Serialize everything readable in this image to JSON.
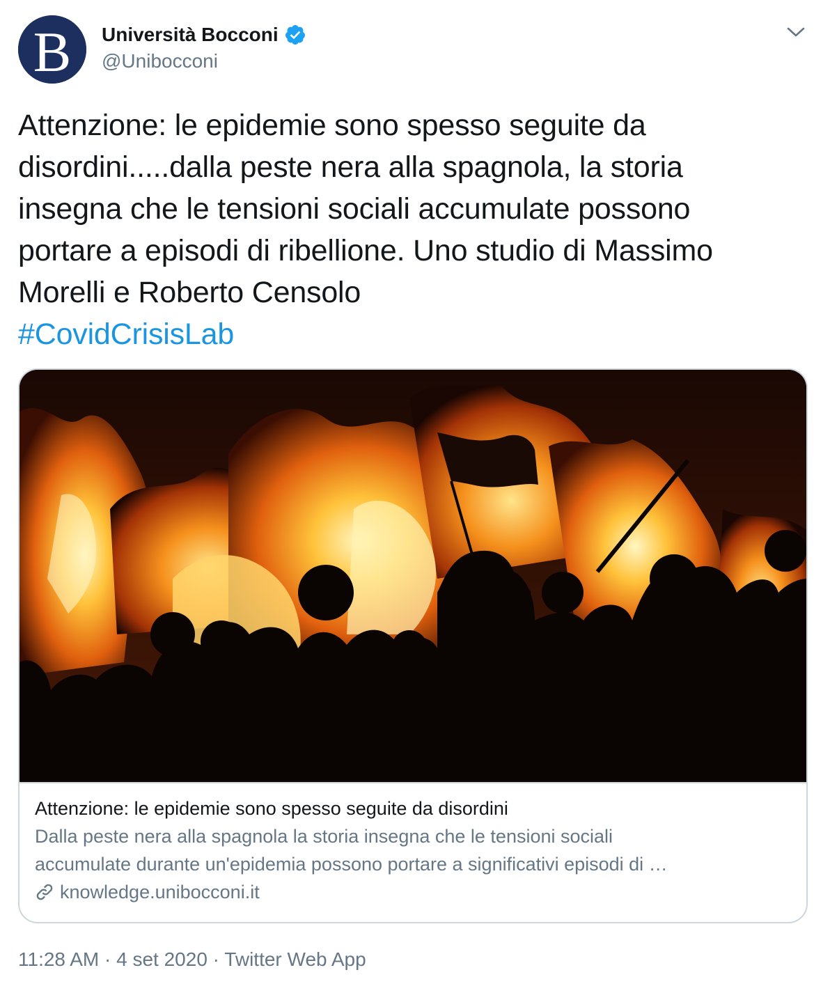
{
  "account": {
    "display_name": "Università Bocconi",
    "handle": "@Unibocconi",
    "avatar_letter": "B",
    "verified": true
  },
  "tweet": {
    "text_lines": [
      "Attenzione: le epidemie sono spesso seguite da",
      "disordini.....dalla peste nera alla spagnola, la storia",
      "insegna che le tensioni sociali accumulate possono",
      "portare a episodi di ribellione. Uno studio di Massimo",
      "Morelli e Roberto Censolo"
    ],
    "hashtag": "#CovidCrisisLab"
  },
  "card": {
    "title": "Attenzione: le epidemie sono spesso seguite da disordini",
    "description_lines": [
      "Dalla peste nera alla spagnola la storia insegna che le tensioni sociali",
      "accumulate durante un'epidemia possono portare a significativi episodi di …"
    ],
    "domain": "knowledge.unibocconi.it"
  },
  "footer": {
    "time": "11:28 AM",
    "separator": " · ",
    "date": "4 set 2020",
    "source": "Twitter Web App"
  },
  "colors": {
    "link_blue": "#1b95e0",
    "verified_blue": "#1da1f2",
    "secondary_text": "#657786",
    "avatar_bg": "#1c2f5e"
  },
  "icons": {
    "verified": "verified-badge-icon",
    "caret": "chevron-down-icon",
    "link": "link-icon"
  }
}
